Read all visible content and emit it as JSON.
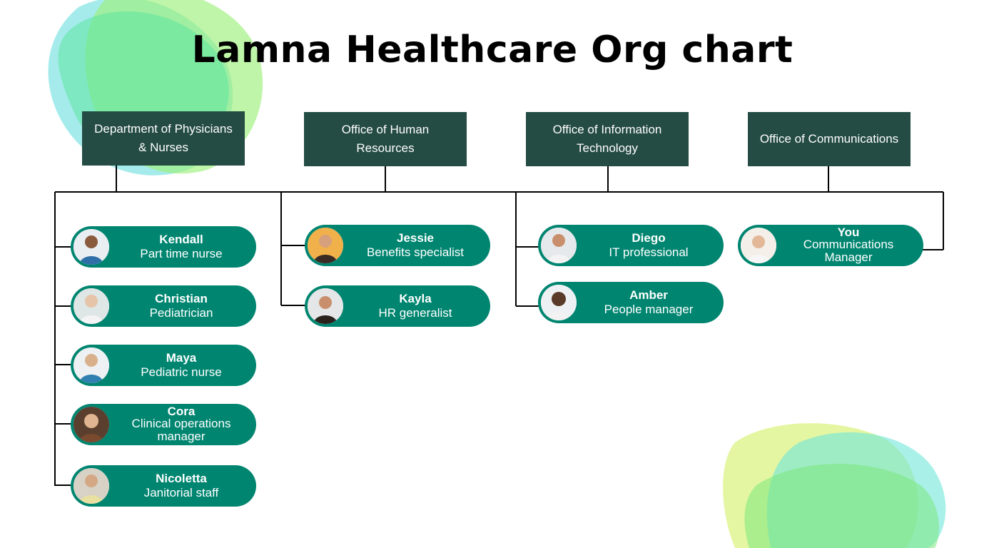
{
  "title": "Lamna Healthcare Org chart",
  "colors": {
    "department_box": "#244b44",
    "member_card": "#008570",
    "connector": "#000000"
  },
  "departments": [
    {
      "label": "Department of Physicians & Nurses",
      "members": [
        {
          "name": "Kendall",
          "role": "Part time nurse",
          "avatar": "photo-avatar"
        },
        {
          "name": "Christian",
          "role": "Pediatrician",
          "avatar": "photo-avatar"
        },
        {
          "name": "Maya",
          "role": "Pediatric nurse",
          "avatar": "photo-avatar"
        },
        {
          "name": "Cora",
          "role": "Clinical operations manager",
          "avatar": "photo-avatar"
        },
        {
          "name": "Nicoletta",
          "role": "Janitorial staff",
          "avatar": "photo-avatar"
        }
      ]
    },
    {
      "label": "Office of Human Resources",
      "members": [
        {
          "name": "Jessie",
          "role": "Benefits specialist",
          "avatar": "photo-avatar"
        },
        {
          "name": "Kayla",
          "role": "HR generalist",
          "avatar": "photo-avatar"
        }
      ]
    },
    {
      "label": "Office of Information Technology",
      "members": [
        {
          "name": "Diego",
          "role": "IT professional",
          "avatar": "photo-avatar"
        },
        {
          "name": "Amber",
          "role": "People manager",
          "avatar": "photo-avatar"
        }
      ]
    },
    {
      "label": "Office of Communications",
      "members": [
        {
          "name": "You",
          "role": "Communications Manager",
          "avatar": "photo-avatar"
        }
      ]
    }
  ]
}
